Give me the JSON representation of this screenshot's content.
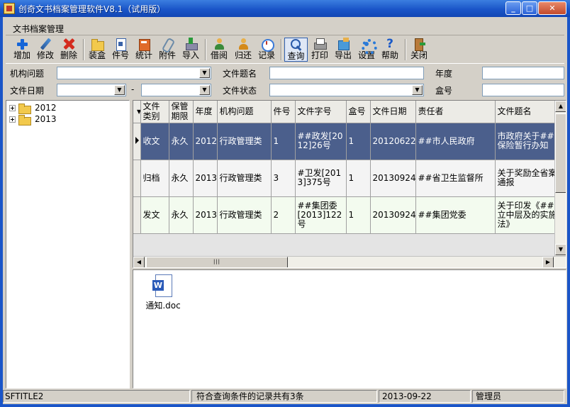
{
  "window": {
    "title": "创奇文书档案管理软件V8.1（试用版）",
    "controls": {
      "minimize": "_",
      "maximize": "□",
      "close": "✕"
    }
  },
  "menu": {
    "label": "文书档案管理"
  },
  "toolbar": {
    "add": "增加",
    "edit": "修改",
    "delete": "删除",
    "box": "装盒",
    "item_no": "件号",
    "stats": "统计",
    "attachment": "附件",
    "import": "导入",
    "borrow": "借阅",
    "return": "归还",
    "record": "记录",
    "query": "查询",
    "print": "打印",
    "export": "导出",
    "settings": "设置",
    "help": "帮助",
    "close": "关闭",
    "icons": [
      "plus-icon",
      "pencil-icon",
      "x-icon",
      "folder-icon",
      "doc-icon",
      "book-icon",
      "paperclip-icon",
      "import-icon",
      "person-icon",
      "person-icon",
      "clock-icon",
      "search-icon",
      "printer-icon",
      "export-icon",
      "gear-icon",
      "help-icon",
      "exit-door-icon"
    ]
  },
  "filter": {
    "org_issue_label": "机构问题",
    "doc_title_label": "文件题名",
    "year_label": "年度",
    "doc_date_label": "文件日期",
    "date_separator": "-",
    "doc_status_label": "文件状态",
    "box_no_label": "盒号"
  },
  "tree": {
    "nodes": [
      {
        "label": "2012"
      },
      {
        "label": "2013"
      }
    ]
  },
  "grid": {
    "columns": [
      "文件类别",
      "保管期限",
      "年度",
      "机构问题",
      "件号",
      "文件字号",
      "盒号",
      "文件日期",
      "责任者",
      "文件题名"
    ],
    "rows": [
      {
        "category": "收文",
        "retention": "永久",
        "year": "2012",
        "org": "行政管理类",
        "item": "1",
        "doc_no": "##政发[2012]26号",
        "box": "1",
        "date": "20120622",
        "responsible": "##市人民政府",
        "title": "市政府关于##医疗保险暂行办知",
        "selected": true
      },
      {
        "category": "归档",
        "retention": "永久",
        "year": "2013",
        "org": "行政管理类",
        "item": "3",
        "doc_no": "#卫发[2013]375号",
        "box": "1",
        "date": "20130924",
        "responsible": "##省卫生监督所",
        "title": "关于奖励全省案例的通报",
        "selected": false
      },
      {
        "category": "发文",
        "retention": "永久",
        "year": "2013",
        "org": "行政管理类",
        "item": "2",
        "doc_no": "##集团委[2013]122号",
        "box": "1",
        "date": "20130924",
        "responsible": "##集团党委",
        "title": "关于印发《##于建立中层及的实施办法》",
        "selected": false
      }
    ]
  },
  "attachments": [
    {
      "name": "通知.doc",
      "icon": "word-doc-icon"
    }
  ],
  "status": {
    "panel_name": "SFTITLE2",
    "message": "符合查询条件的记录共有3条",
    "date": "2013-09-22",
    "user": "管理员"
  },
  "colors": {
    "titlebar": "#1a55c8",
    "selected_row": "#4b5f8c",
    "window_bg": "#d4d0c8"
  }
}
